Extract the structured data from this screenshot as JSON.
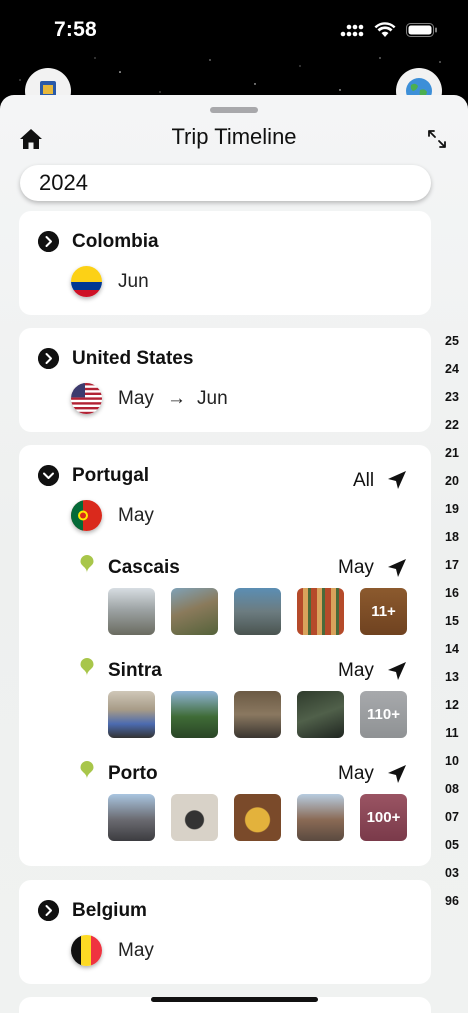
{
  "status_bar": {
    "time": "7:58"
  },
  "sheet": {
    "title": "Trip Timeline",
    "year": "2024"
  },
  "countries": [
    {
      "name": "Colombia",
      "months": "Jun"
    },
    {
      "name": "United States",
      "month_from": "May",
      "arrow": "→",
      "month_to": "Jun"
    },
    {
      "name": "Portugal",
      "months": "May",
      "filter_label": "All",
      "cities": [
        {
          "name": "Cascais",
          "month": "May",
          "more": "11+"
        },
        {
          "name": "Sintra",
          "month": "May",
          "more": "110+"
        },
        {
          "name": "Porto",
          "month": "May",
          "more": "100+"
        }
      ]
    },
    {
      "name": "Belgium",
      "months": "May"
    }
  ],
  "scrubber_labels": [
    "25",
    "24",
    "23",
    "22",
    "21",
    "20",
    "19",
    "18",
    "17",
    "16",
    "15",
    "14",
    "13",
    "12",
    "11",
    "10",
    "08",
    "07",
    "05",
    "03",
    "96"
  ],
  "icons": {
    "home": "house-icon",
    "expand": "expand-arrows-icon",
    "chevron": "chevron-right-circle-icon",
    "chevron_open": "chevron-down-circle-icon",
    "navigate": "location-arrow-icon",
    "pin": "map-pin-icon",
    "left_floating": "passport-icon",
    "right_floating": "globe-icon"
  },
  "colors": {
    "pin": "#a8c64a",
    "accent": "#111111"
  }
}
